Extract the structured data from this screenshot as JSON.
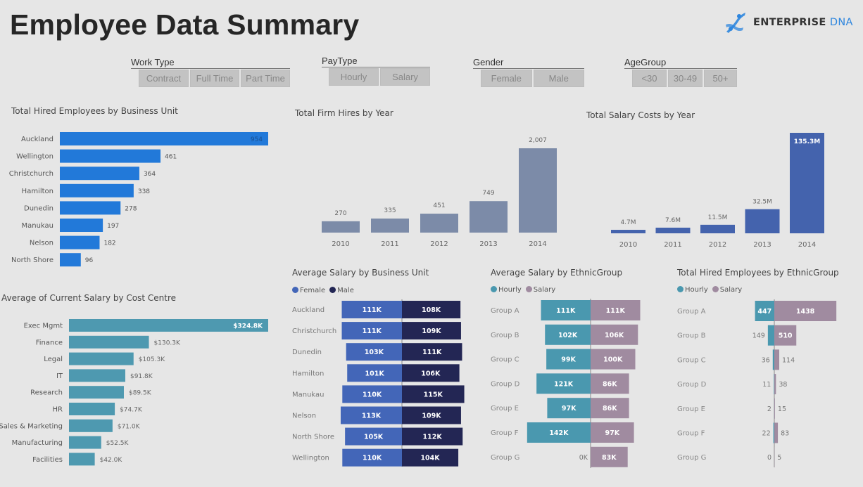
{
  "header": {
    "title": "Employee Data Summary",
    "logo": {
      "brand": "ENTERPRISE",
      "suffix": "DNA",
      "icon": "dna-helix-icon"
    }
  },
  "colors": {
    "background": "#e6e6e6",
    "hires_bu": "#2279d9",
    "salary_cc": "#4e99b0",
    "firm_hires": "#7c8ba8",
    "salary_costs": "#4463ad",
    "female": "#4366b8",
    "male": "#232654",
    "hourly": "#4a98af",
    "salary": "#a08ba0"
  },
  "slicers": [
    {
      "label": "Work Type",
      "options": [
        "Contract",
        "Full Time",
        "Part Time"
      ]
    },
    {
      "label": "PayType",
      "options": [
        "Hourly",
        "Salary"
      ]
    },
    {
      "label": "Gender",
      "options": [
        "Female",
        "Male"
      ]
    },
    {
      "label": "AgeGroup",
      "options": [
        "<30",
        "30-49",
        "50+"
      ]
    }
  ],
  "chart_data": [
    {
      "id": "hires_by_bu",
      "type": "bar",
      "orientation": "horizontal",
      "title": "Total Hired Employees by Business Unit",
      "categories": [
        "Auckland",
        "Wellington",
        "Christchurch",
        "Hamilton",
        "Dunedin",
        "Manukau",
        "Nelson",
        "North Shore"
      ],
      "values": [
        954,
        461,
        364,
        338,
        278,
        197,
        182,
        96
      ],
      "labels": [
        "954",
        "461",
        "364",
        "338",
        "278",
        "197",
        "182",
        "96"
      ],
      "xlim": [
        0,
        954
      ]
    },
    {
      "id": "salary_by_cost_centre",
      "type": "bar",
      "orientation": "horizontal",
      "title": "Average of Current Salary by Cost Centre",
      "categories": [
        "Exec Mgmt",
        "Finance",
        "Legal",
        "IT",
        "Research",
        "HR",
        "Sales & Marketing",
        "Manufacturing",
        "Facilities"
      ],
      "values": [
        324.8,
        130.3,
        105.3,
        91.8,
        89.5,
        74.7,
        71.0,
        52.5,
        42.0
      ],
      "labels": [
        "$324.8K",
        "$130.3K",
        "$105.3K",
        "$91.8K",
        "$89.5K",
        "$74.7K",
        "$71.0K",
        "$52.5K",
        "$42.0K"
      ],
      "unit": "$K",
      "xlim": [
        0,
        324.8
      ]
    },
    {
      "id": "firm_hires_by_year",
      "type": "bar",
      "title": "Total Firm Hires by Year",
      "categories": [
        "2010",
        "2011",
        "2012",
        "2013",
        "2014"
      ],
      "values": [
        270,
        335,
        451,
        749,
        2007
      ],
      "labels": [
        "270",
        "335",
        "451",
        "749",
        "2,007"
      ],
      "ylim": [
        0,
        2007
      ]
    },
    {
      "id": "salary_costs_by_year",
      "type": "bar",
      "title": "Total Salary Costs by Year",
      "categories": [
        "2010",
        "2011",
        "2012",
        "2013",
        "2014"
      ],
      "values": [
        4.7,
        7.6,
        11.5,
        32.5,
        135.3
      ],
      "labels": [
        "4.7M",
        "7.6M",
        "11.5M",
        "32.5M",
        "135.3M"
      ],
      "unit": "M",
      "ylim": [
        0,
        135.3
      ]
    },
    {
      "id": "avg_salary_by_bu",
      "type": "bar",
      "orientation": "diverging",
      "title": "Average Salary by Business Unit",
      "categories": [
        "Auckland",
        "Christchurch",
        "Dunedin",
        "Hamilton",
        "Manukau",
        "Nelson",
        "North Shore",
        "Wellington"
      ],
      "series": [
        {
          "name": "Female",
          "values": [
            111,
            111,
            103,
            101,
            110,
            113,
            105,
            110
          ],
          "labels": [
            "111K",
            "111K",
            "103K",
            "101K",
            "110K",
            "113K",
            "105K",
            "110K"
          ]
        },
        {
          "name": "Male",
          "values": [
            108,
            109,
            111,
            106,
            115,
            109,
            112,
            104
          ],
          "labels": [
            "108K",
            "109K",
            "111K",
            "106K",
            "115K",
            "109K",
            "112K",
            "104K"
          ]
        }
      ],
      "unit": "K",
      "legend": "top-left",
      "xlim": [
        0,
        130
      ]
    },
    {
      "id": "avg_salary_by_ethnic",
      "type": "bar",
      "orientation": "diverging",
      "title": "Average Salary by EthnicGroup",
      "categories": [
        "Group A",
        "Group B",
        "Group C",
        "Group D",
        "Group E",
        "Group F",
        "Group G"
      ],
      "series": [
        {
          "name": "Hourly",
          "values": [
            111,
            102,
            99,
            121,
            97,
            142,
            0
          ],
          "labels": [
            "111K",
            "102K",
            "99K",
            "121K",
            "97K",
            "142K",
            "0K"
          ]
        },
        {
          "name": "Salary",
          "values": [
            111,
            106,
            100,
            86,
            86,
            97,
            83
          ],
          "labels": [
            "111K",
            "106K",
            "100K",
            "86K",
            "86K",
            "97K",
            "83K"
          ]
        }
      ],
      "unit": "K",
      "legend": "top-left",
      "xlim": [
        0,
        150
      ]
    },
    {
      "id": "hires_by_ethnic",
      "type": "bar",
      "orientation": "diverging",
      "title": "Total Hired Employees by EthnicGroup",
      "categories": [
        "Group A",
        "Group B",
        "Group C",
        "Group D",
        "Group E",
        "Group F",
        "Group G"
      ],
      "series": [
        {
          "name": "Hourly",
          "values": [
            447,
            149,
            36,
            11,
            2,
            22,
            0
          ],
          "labels": [
            "447",
            "149",
            "36",
            "11",
            "2",
            "22",
            "0"
          ]
        },
        {
          "name": "Salary",
          "values": [
            1438,
            510,
            114,
            38,
            15,
            83,
            5
          ],
          "labels": [
            "1438",
            "510",
            "114",
            "38",
            "15",
            "83",
            "5"
          ]
        }
      ],
      "legend": "top-left",
      "xlim": [
        0,
        1438
      ]
    }
  ]
}
